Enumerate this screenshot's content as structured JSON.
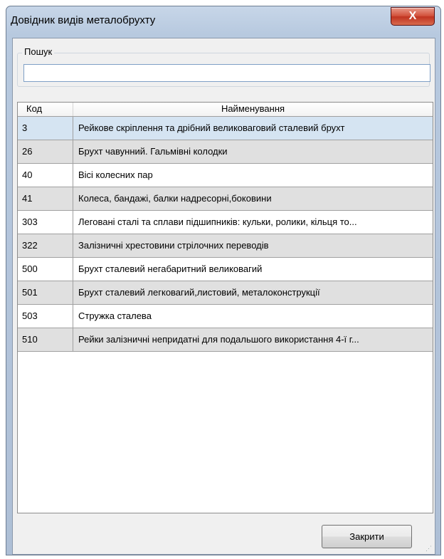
{
  "window": {
    "title": "Довідник видів металобрухту",
    "close_glyph": "X"
  },
  "search": {
    "label": "Пошук",
    "value": "",
    "placeholder": ""
  },
  "grid": {
    "columns": [
      "Код",
      "Найменування"
    ],
    "rows": [
      {
        "code": "3",
        "name": "Рейкове скріплення та дрібний великоваговий сталевий брухт"
      },
      {
        "code": "26",
        "name": "Брухт чавунний. Гальмівні колодки"
      },
      {
        "code": "40",
        "name": "Вісі колесних пар"
      },
      {
        "code": "41",
        "name": "Колеса, бандажі, балки надресорні,боковини"
      },
      {
        "code": "303",
        "name": "Леговані сталі та сплави підшипників: кульки, ролики, кільця то..."
      },
      {
        "code": "322",
        "name": "Залізничні хрестовини стрілочних переводів"
      },
      {
        "code": "500",
        "name": "Брухт сталевий негабаритний великовагий"
      },
      {
        "code": "501",
        "name": "Брухт сталевий легковагий,листовий, металоконструкції"
      },
      {
        "code": "503",
        "name": "Стружка сталева"
      },
      {
        "code": "510",
        "name": "Рейки залізничні непридатні для подальшого використання 4-ї г..."
      }
    ],
    "selected_index": 0
  },
  "footer": {
    "close_label": "Закрити"
  }
}
